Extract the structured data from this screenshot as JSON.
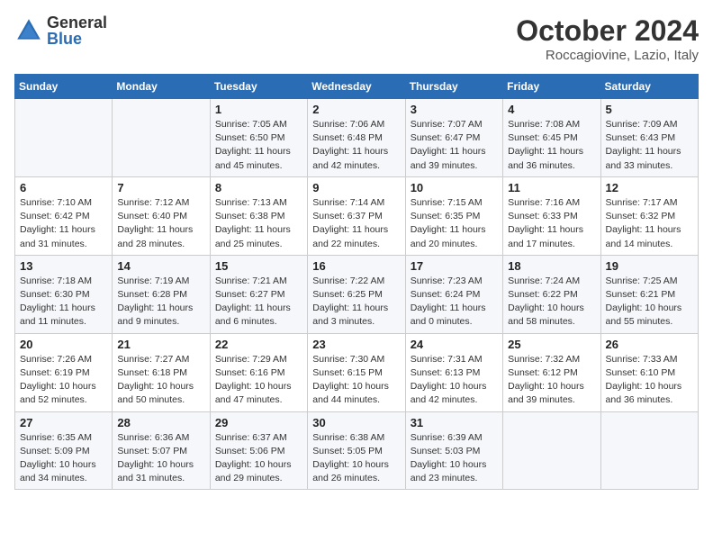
{
  "logo": {
    "general": "General",
    "blue": "Blue"
  },
  "title": "October 2024",
  "subtitle": "Roccagiovine, Lazio, Italy",
  "weekdays": [
    "Sunday",
    "Monday",
    "Tuesday",
    "Wednesday",
    "Thursday",
    "Friday",
    "Saturday"
  ],
  "weeks": [
    [
      {
        "day": "",
        "info": ""
      },
      {
        "day": "",
        "info": ""
      },
      {
        "day": "1",
        "info": "Sunrise: 7:05 AM\nSunset: 6:50 PM\nDaylight: 11 hours and 45 minutes."
      },
      {
        "day": "2",
        "info": "Sunrise: 7:06 AM\nSunset: 6:48 PM\nDaylight: 11 hours and 42 minutes."
      },
      {
        "day": "3",
        "info": "Sunrise: 7:07 AM\nSunset: 6:47 PM\nDaylight: 11 hours and 39 minutes."
      },
      {
        "day": "4",
        "info": "Sunrise: 7:08 AM\nSunset: 6:45 PM\nDaylight: 11 hours and 36 minutes."
      },
      {
        "day": "5",
        "info": "Sunrise: 7:09 AM\nSunset: 6:43 PM\nDaylight: 11 hours and 33 minutes."
      }
    ],
    [
      {
        "day": "6",
        "info": "Sunrise: 7:10 AM\nSunset: 6:42 PM\nDaylight: 11 hours and 31 minutes."
      },
      {
        "day": "7",
        "info": "Sunrise: 7:12 AM\nSunset: 6:40 PM\nDaylight: 11 hours and 28 minutes."
      },
      {
        "day": "8",
        "info": "Sunrise: 7:13 AM\nSunset: 6:38 PM\nDaylight: 11 hours and 25 minutes."
      },
      {
        "day": "9",
        "info": "Sunrise: 7:14 AM\nSunset: 6:37 PM\nDaylight: 11 hours and 22 minutes."
      },
      {
        "day": "10",
        "info": "Sunrise: 7:15 AM\nSunset: 6:35 PM\nDaylight: 11 hours and 20 minutes."
      },
      {
        "day": "11",
        "info": "Sunrise: 7:16 AM\nSunset: 6:33 PM\nDaylight: 11 hours and 17 minutes."
      },
      {
        "day": "12",
        "info": "Sunrise: 7:17 AM\nSunset: 6:32 PM\nDaylight: 11 hours and 14 minutes."
      }
    ],
    [
      {
        "day": "13",
        "info": "Sunrise: 7:18 AM\nSunset: 6:30 PM\nDaylight: 11 hours and 11 minutes."
      },
      {
        "day": "14",
        "info": "Sunrise: 7:19 AM\nSunset: 6:28 PM\nDaylight: 11 hours and 9 minutes."
      },
      {
        "day": "15",
        "info": "Sunrise: 7:21 AM\nSunset: 6:27 PM\nDaylight: 11 hours and 6 minutes."
      },
      {
        "day": "16",
        "info": "Sunrise: 7:22 AM\nSunset: 6:25 PM\nDaylight: 11 hours and 3 minutes."
      },
      {
        "day": "17",
        "info": "Sunrise: 7:23 AM\nSunset: 6:24 PM\nDaylight: 11 hours and 0 minutes."
      },
      {
        "day": "18",
        "info": "Sunrise: 7:24 AM\nSunset: 6:22 PM\nDaylight: 10 hours and 58 minutes."
      },
      {
        "day": "19",
        "info": "Sunrise: 7:25 AM\nSunset: 6:21 PM\nDaylight: 10 hours and 55 minutes."
      }
    ],
    [
      {
        "day": "20",
        "info": "Sunrise: 7:26 AM\nSunset: 6:19 PM\nDaylight: 10 hours and 52 minutes."
      },
      {
        "day": "21",
        "info": "Sunrise: 7:27 AM\nSunset: 6:18 PM\nDaylight: 10 hours and 50 minutes."
      },
      {
        "day": "22",
        "info": "Sunrise: 7:29 AM\nSunset: 6:16 PM\nDaylight: 10 hours and 47 minutes."
      },
      {
        "day": "23",
        "info": "Sunrise: 7:30 AM\nSunset: 6:15 PM\nDaylight: 10 hours and 44 minutes."
      },
      {
        "day": "24",
        "info": "Sunrise: 7:31 AM\nSunset: 6:13 PM\nDaylight: 10 hours and 42 minutes."
      },
      {
        "day": "25",
        "info": "Sunrise: 7:32 AM\nSunset: 6:12 PM\nDaylight: 10 hours and 39 minutes."
      },
      {
        "day": "26",
        "info": "Sunrise: 7:33 AM\nSunset: 6:10 PM\nDaylight: 10 hours and 36 minutes."
      }
    ],
    [
      {
        "day": "27",
        "info": "Sunrise: 6:35 AM\nSunset: 5:09 PM\nDaylight: 10 hours and 34 minutes."
      },
      {
        "day": "28",
        "info": "Sunrise: 6:36 AM\nSunset: 5:07 PM\nDaylight: 10 hours and 31 minutes."
      },
      {
        "day": "29",
        "info": "Sunrise: 6:37 AM\nSunset: 5:06 PM\nDaylight: 10 hours and 29 minutes."
      },
      {
        "day": "30",
        "info": "Sunrise: 6:38 AM\nSunset: 5:05 PM\nDaylight: 10 hours and 26 minutes."
      },
      {
        "day": "31",
        "info": "Sunrise: 6:39 AM\nSunset: 5:03 PM\nDaylight: 10 hours and 23 minutes."
      },
      {
        "day": "",
        "info": ""
      },
      {
        "day": "",
        "info": ""
      }
    ]
  ]
}
